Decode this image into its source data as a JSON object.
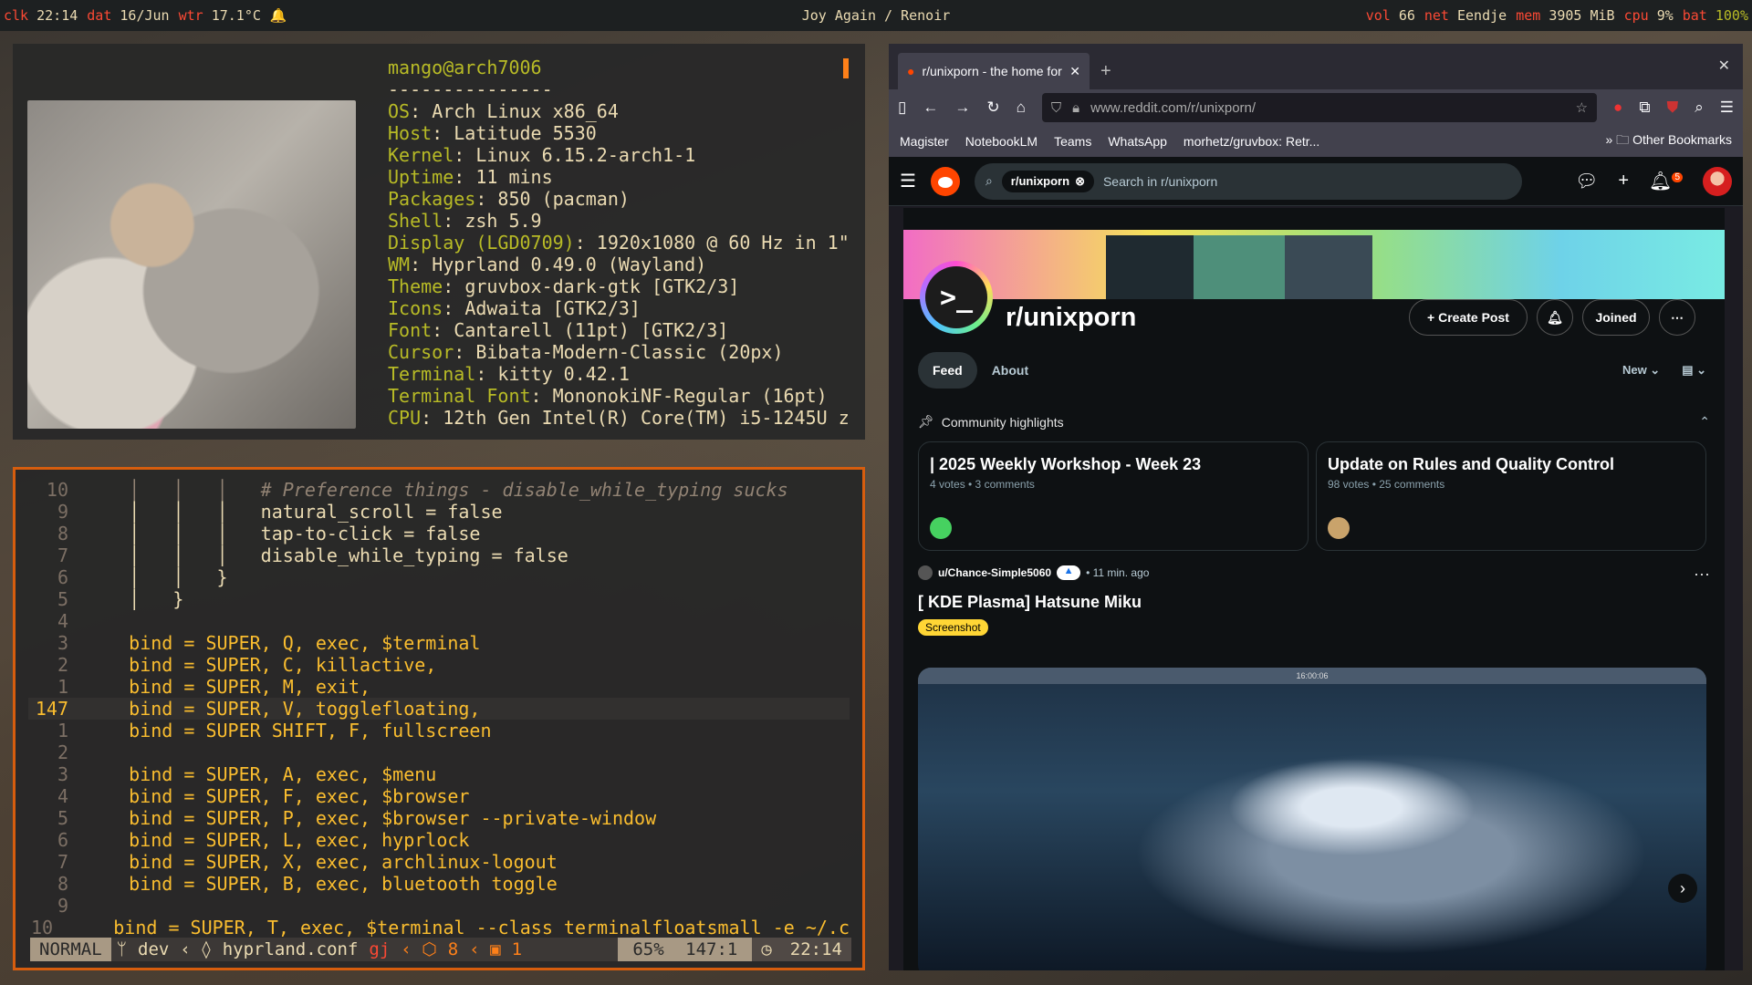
{
  "topbar": {
    "left": [
      {
        "k": "clk",
        "v": "22:14"
      },
      {
        "k": "dat",
        "v": "16/Jun"
      },
      {
        "k": "wtr",
        "v": "17.1°C"
      }
    ],
    "bell": "🔔",
    "center": "Joy Again / Renoir",
    "right": [
      {
        "k": "vol",
        "v": "66"
      },
      {
        "k": "net",
        "v": "Eendje"
      },
      {
        "k": "mem",
        "v": "3905 MiB"
      },
      {
        "k": "cpu",
        "v": "9%"
      },
      {
        "k": "bat",
        "v": "100%"
      }
    ]
  },
  "fastfetch": {
    "user": "mango@arch7006",
    "sep": "---------------",
    "lines": [
      {
        "l": "OS",
        "v": "Arch Linux x86_64"
      },
      {
        "l": "Host",
        "v": "Latitude 5530"
      },
      {
        "l": "Kernel",
        "v": "Linux 6.15.2-arch1-1"
      },
      {
        "l": "Uptime",
        "v": "11 mins"
      },
      {
        "l": "Packages",
        "v": "850 (pacman)"
      },
      {
        "l": "Shell",
        "v": "zsh 5.9"
      },
      {
        "l": "Display (LGD0709)",
        "v": "1920x1080 @ 60 Hz in 1\""
      },
      {
        "l": "WM",
        "v": "Hyprland 0.49.0 (Wayland)"
      },
      {
        "l": "Theme",
        "v": "gruvbox-dark-gtk [GTK2/3]"
      },
      {
        "l": "Icons",
        "v": "Adwaita [GTK2/3]"
      },
      {
        "l": "Font",
        "v": "Cantarell (11pt) [GTK2/3]"
      },
      {
        "l": "Cursor",
        "v": "Bibata-Modern-Classic (20px)"
      },
      {
        "l": "Terminal",
        "v": "kitty 0.42.1"
      },
      {
        "l": "Terminal Font",
        "v": "MononokiNF-Regular (16pt)"
      },
      {
        "l": "CPU",
        "v": "12th Gen Intel(R) Core(TM) i5-1245U z"
      }
    ]
  },
  "editor": {
    "lines": [
      {
        "n": "10",
        "t": "    │   │   │   # Preference things - disable_while_typing sucks",
        "c": "cmt"
      },
      {
        "n": "9",
        "t": "    │   │   │   natural_scroll = false",
        "c": "plain"
      },
      {
        "n": "8",
        "t": "    │   │   │   tap-to-click = false",
        "c": "plain"
      },
      {
        "n": "7",
        "t": "    │   │   │   disable_while_typing = false",
        "c": "plain"
      },
      {
        "n": "6",
        "t": "    │   │   }",
        "c": "plain"
      },
      {
        "n": "5",
        "t": "    │   }",
        "c": "plain"
      },
      {
        "n": "4",
        "t": "",
        "c": "plain"
      },
      {
        "n": "3",
        "t": "    bind = SUPER, Q, exec, $terminal",
        "c": "bind"
      },
      {
        "n": "2",
        "t": "    bind = SUPER, C, killactive,",
        "c": "bind"
      },
      {
        "n": "1",
        "t": "    bind = SUPER, M, exit,",
        "c": "bind"
      },
      {
        "n": "147",
        "t": "    bind = SUPER, V, togglefloating,",
        "c": "bind",
        "cur": true
      },
      {
        "n": "1",
        "t": "    bind = SUPER SHIFT, F, fullscreen",
        "c": "bind"
      },
      {
        "n": "2",
        "t": "",
        "c": "plain"
      },
      {
        "n": "3",
        "t": "    bind = SUPER, A, exec, $menu",
        "c": "bind"
      },
      {
        "n": "4",
        "t": "    bind = SUPER, F, exec, $browser",
        "c": "bind"
      },
      {
        "n": "5",
        "t": "    bind = SUPER, P, exec, $browser --private-window",
        "c": "bind"
      },
      {
        "n": "6",
        "t": "    bind = SUPER, L, exec, hyprlock",
        "c": "bind"
      },
      {
        "n": "7",
        "t": "    bind = SUPER, X, exec, archlinux-logout",
        "c": "bind"
      },
      {
        "n": "8",
        "t": "    bind = SUPER, B, exec, bluetooth toggle",
        "c": "bind"
      },
      {
        "n": "9",
        "t": "",
        "c": "plain"
      },
      {
        "n": "10",
        "t": "    bind = SUPER, T, exec, $terminal --class terminalfloatsmall -e ~/.c",
        "c": "bind"
      }
    ],
    "status": {
      "mode": "NORMAL",
      "branch": "dev",
      "file": "hyprland.conf",
      "flag": "gj",
      "pkgs": "8",
      "edits": "1",
      "pct": "65%",
      "pos": "147:1",
      "time": "22:14"
    }
  },
  "browser": {
    "tab_title": "r/unixporn - the home for",
    "url": "www.reddit.com/r/unixporn/",
    "bookmarks": [
      "Magister",
      "NotebookLM",
      "Teams",
      "WhatsApp",
      "morhetz/gruvbox: Retr..."
    ],
    "other_bookmarks": "Other Bookmarks",
    "search_chip": "r/unixporn",
    "search_placeholder": "Search in r/unixporn",
    "notif_count": "5",
    "sub_icon_text": ">_",
    "subname": "r/unixporn",
    "create_post": "Create Post",
    "joined": "Joined",
    "tab_feed": "Feed",
    "tab_about": "About",
    "sort": "New",
    "highlights_label": "Community highlights",
    "highlights": [
      {
        "title": "| 2025 Weekly Workshop - Week 23",
        "meta": "4 votes • 3 comments"
      },
      {
        "title": "Update on Rules and Quality Control",
        "meta": "98 votes • 25 comments"
      }
    ],
    "post": {
      "user": "u/Chance-Simple5060",
      "time": "• 11 min. ago",
      "title": "[ KDE Plasma] Hatsune Miku",
      "flair": "Screenshot",
      "img_bar": "16:00:06"
    }
  },
  "colors": {
    "gruv_red": "#fb4934",
    "gruv_yellow": "#fabd2f",
    "gruv_orange": "#d65d0e",
    "reddit_orange": "#ff4500"
  }
}
